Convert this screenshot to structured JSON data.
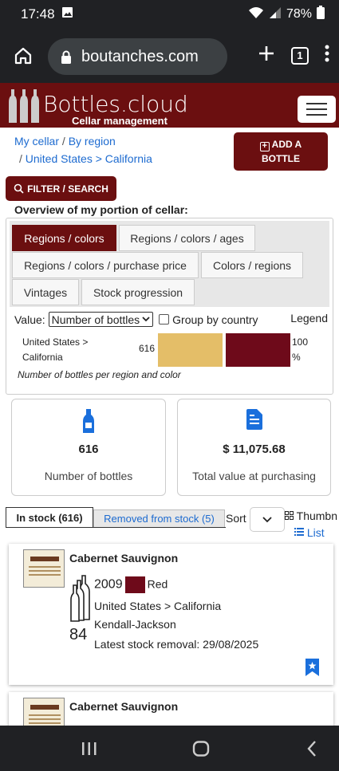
{
  "status": {
    "time": "17:48",
    "battery": "78%"
  },
  "browser": {
    "url": "boutanches.com",
    "tab_count": "1"
  },
  "header": {
    "logo_text": "Bottles.cloud",
    "logo_sub": "Cellar management"
  },
  "breadcrumb": {
    "item1": "My cellar",
    "sep1": "/",
    "item2": "By region",
    "sep2": "/",
    "item3": "United States > California"
  },
  "buttons": {
    "add_line1": "ADD A",
    "add_line2": "BOTTLE",
    "filter": "FILTER / SEARCH"
  },
  "overview": {
    "title": "Overview of my portion of cellar:",
    "tabs": [
      "Regions / colors",
      "Regions / colors / ages",
      "Regions / colors / purchase price",
      "Colors / regions",
      "Vintages",
      "Stock progression"
    ],
    "value_label": "Value:",
    "value_select": "Number of bottles",
    "group_label": "Group by country",
    "legend_label": "Legend",
    "region_line1": "United States >",
    "region_line2": "California",
    "count": "616",
    "pct_line1": "100",
    "pct_line2": "%",
    "note": "Number of bottles per region and color"
  },
  "chart_data": {
    "type": "bar",
    "categories": [
      "United States > California"
    ],
    "series": [
      {
        "color": "#e4be68",
        "values": [
          1
        ]
      },
      {
        "color": "#6e0a1a",
        "values": [
          1
        ]
      }
    ],
    "total": 616
  },
  "cards": {
    "bottles_value": "616",
    "bottles_label": "Number of bottles",
    "value_value": "$ 11,075.68",
    "value_label": "Total value at purchasing"
  },
  "stock": {
    "in_stock_tab": "In stock (616)",
    "removed_tab": "Removed from stock (5)",
    "sort_label": "Sort",
    "thumbnails": "Thumbn",
    "list": "List"
  },
  "wines": [
    {
      "name": "Cabernet Sauvignon",
      "vintage": "2009",
      "color": "Red",
      "region": "United States > California",
      "producer": "Kendall-Jackson",
      "latest_removal": "Latest stock removal: 29/08/2025",
      "count": "84"
    },
    {
      "name": "Cabernet Sauvignon"
    }
  ]
}
